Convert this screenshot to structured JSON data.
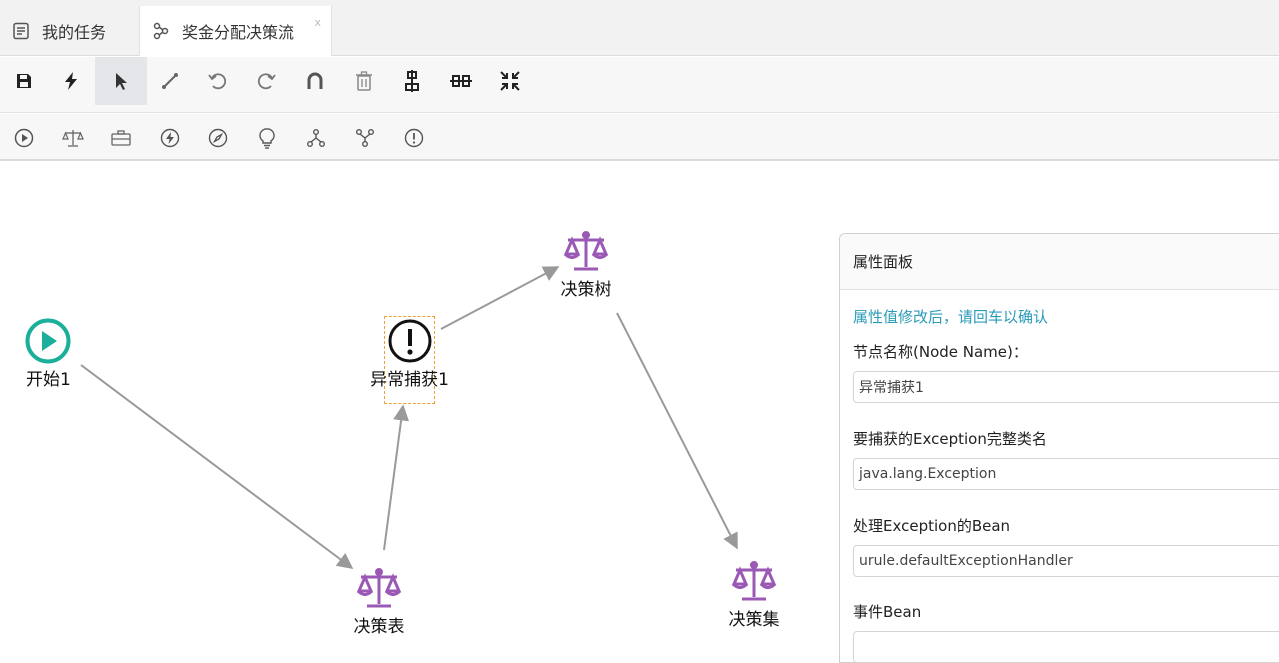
{
  "tabs": [
    {
      "label": "我的任务",
      "icon": "task-list-icon"
    },
    {
      "label": "奖金分配决策流",
      "icon": "flow-icon",
      "close": "x"
    }
  ],
  "toolbar1": [
    {
      "name": "save-icon"
    },
    {
      "name": "deploy-bolt-icon"
    },
    {
      "name": "select-pointer-icon",
      "active": true
    },
    {
      "name": "connection-line-icon"
    },
    {
      "name": "undo-icon"
    },
    {
      "name": "redo-icon"
    },
    {
      "name": "magnet-icon"
    },
    {
      "name": "delete-trash-icon"
    },
    {
      "name": "align-vertical-icon"
    },
    {
      "name": "align-horizontal-icon"
    },
    {
      "name": "compress-icon"
    }
  ],
  "toolbar2": [
    {
      "name": "start-node-icon"
    },
    {
      "name": "rule-scale-icon"
    },
    {
      "name": "briefcase-icon"
    },
    {
      "name": "action-bolt-icon"
    },
    {
      "name": "script-compass-icon"
    },
    {
      "name": "decision-bulb-icon"
    },
    {
      "name": "fork-icon"
    },
    {
      "name": "join-icon"
    },
    {
      "name": "exception-icon"
    }
  ],
  "nodes": {
    "start": "开始1",
    "exception": "异常捕获1",
    "decision_tree": "决策树",
    "decision_table": "决策表",
    "decision_set": "决策集"
  },
  "panel": {
    "title": "属性面板",
    "hint": "属性值修改后，请回车以确认",
    "node_name_label": "节点名称(Node Name)：",
    "node_name_value": "异常捕获1",
    "exception_class_label": "要捕获的Exception完整类名",
    "exception_class_value": "java.lang.Exception",
    "handler_bean_label": "处理Exception的Bean",
    "handler_bean_value": "urule.defaultExceptionHandler",
    "event_bean_label": "事件Bean",
    "event_bean_value": ""
  },
  "colors": {
    "accent_start": "#1aaf9a",
    "decision_purple": "#9b59b6",
    "hint_blue": "#2a9bb8",
    "selection_orange": "#f0a030"
  }
}
